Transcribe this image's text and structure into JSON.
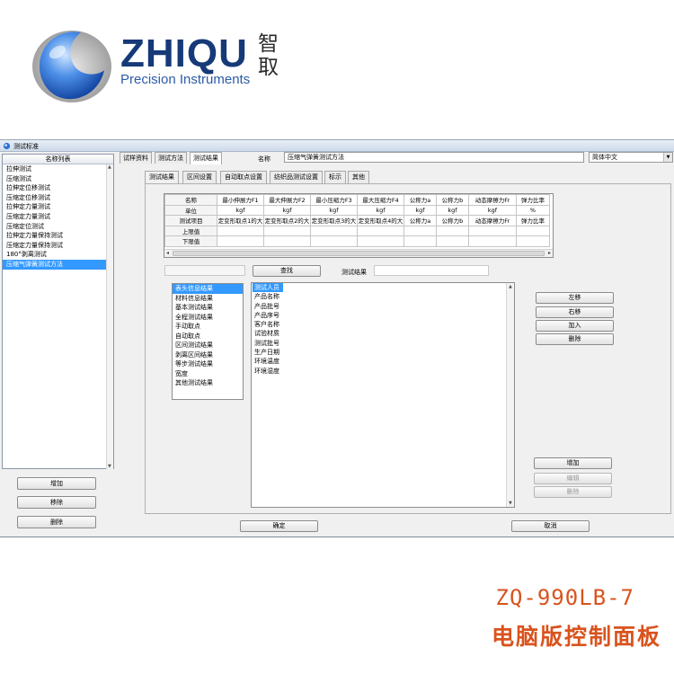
{
  "brand": {
    "name": "ZHIQU",
    "name_cn": "智\n取",
    "subtitle": "Precision Instruments",
    "colors": {
      "primary": "#163a78",
      "orb": "#2f6fd6"
    }
  },
  "window": {
    "title": "测试标准",
    "icon": "app-icon"
  },
  "left_panel": {
    "header": "名称列表",
    "items": [
      "拉伸测试",
      "压缩测试",
      "拉伸定位移测试",
      "压缩定位移测试",
      "拉伸定力量测试",
      "压缩定力量测试",
      "压缩定位测试",
      "拉伸定力量保持测试",
      "压缩定力量保持测试",
      "180°剥离测试",
      "压缩气弹簧测试方法"
    ],
    "selected_index": 10,
    "buttons": {
      "add": "增加",
      "remove": "移除",
      "delete": "删除"
    }
  },
  "top_tabs": [
    "试样资料",
    "测试方法",
    "测试结果"
  ],
  "top_tabs_active": 2,
  "name_field": {
    "label": "名称",
    "value": "压缩气弹簧测试方法"
  },
  "language": {
    "value": "简体中文"
  },
  "sub_tabs": [
    "测试结果",
    "区间设置",
    "自动取点设置",
    "纺织品测试设置",
    "标示",
    "其他"
  ],
  "sub_tabs_active": 0,
  "grid": {
    "row_headers": [
      "名称",
      "单位",
      "测试项目",
      "上限值",
      "下限值"
    ],
    "columns": [
      {
        "name": "最小伸展力F1",
        "unit": "kgf",
        "item": "定变形取点1的大"
      },
      {
        "name": "最大伸展力F2",
        "unit": "kgf",
        "item": "定变形取点2的大"
      },
      {
        "name": "最小压缩力F3",
        "unit": "kgf",
        "item": "定变形取点3的大"
      },
      {
        "name": "最大压缩力F4",
        "unit": "kgf",
        "item": "定变形取点4的大"
      },
      {
        "name": "公称力a",
        "unit": "kgf",
        "item": "公称力a"
      },
      {
        "name": "公称力b",
        "unit": "kgf",
        "item": "公称力b"
      },
      {
        "name": "动态摩擦力Fr",
        "unit": "kgf",
        "item": "动态摩擦力Fr"
      },
      {
        "name": "弹力比率",
        "unit": "%",
        "item": "弹力比率"
      }
    ]
  },
  "search": {
    "button": "查找",
    "label": "测试结果"
  },
  "category_list": {
    "items": [
      "表头信息结果",
      "材料信息结果",
      "基本测试结果",
      "全程测试结果",
      "手动取点",
      "自动取点",
      "区间测试结果",
      "剥离区间结果",
      "等步测试结果",
      "宽度",
      "其他测试结果"
    ],
    "selected_index": 0
  },
  "field_list": {
    "items": [
      "测试人员",
      "产品名称",
      "产品批号",
      "产品序号",
      "客户名称",
      "试验材质",
      "测试批号",
      "生产日期",
      "环境温度",
      "环境湿度"
    ],
    "selected_index": 0
  },
  "right_buttons": {
    "left": "左移",
    "right": "右移",
    "add": "加入",
    "delete": "删除"
  },
  "lower_buttons": {
    "add": "增加",
    "edit": "编辑",
    "delete": "删除"
  },
  "footer_buttons": {
    "ok": "确定",
    "cancel": "取消"
  },
  "product": {
    "model": "ZQ-990LB-7",
    "caption": "电脑版控制面板",
    "color": "#d9531e"
  }
}
